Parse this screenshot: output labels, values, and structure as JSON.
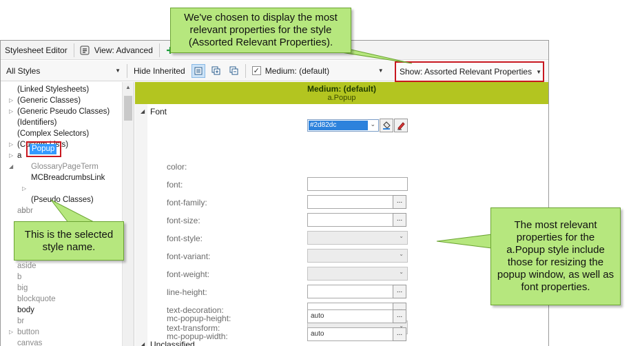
{
  "toolbar1": {
    "title": "Stylesheet Editor",
    "view_label": "View: Advanced"
  },
  "toolbar2": {
    "styles_select": "All Styles",
    "hide_inherited": "Hide Inherited",
    "medium_select": "Medium: (default)",
    "show_select": "Show: Assorted Relevant Properties"
  },
  "tree": {
    "items": [
      "(Linked Stylesheets)",
      "(Generic Classes)",
      "(Generic Pseudo Classes)",
      "(Identifiers)",
      "(Complex Selectors)",
      "(Custom Lists)",
      "a",
      "GlossaryPageTerm",
      "MCBreadcrumbsLink",
      "Popup",
      "(Pseudo Classes)",
      "abbr",
      "aside",
      "b",
      "big",
      "blockquote",
      "body",
      "br",
      "button",
      "canvas"
    ]
  },
  "props": {
    "header_title": "Medium: (default)",
    "header_subtitle": "a.Popup",
    "group_font": "Font",
    "group_unclassified": "Unclassified",
    "rows": [
      {
        "label": "color:",
        "value": "#2d82dc"
      },
      {
        "label": "font:",
        "value": ""
      },
      {
        "label": "font-family:",
        "value": ""
      },
      {
        "label": "font-size:",
        "value": ""
      },
      {
        "label": "font-style:",
        "value": ""
      },
      {
        "label": "font-variant:",
        "value": ""
      },
      {
        "label": "font-weight:",
        "value": ""
      },
      {
        "label": "line-height:",
        "value": ""
      },
      {
        "label": "text-decoration:",
        "value": ""
      },
      {
        "label": "text-transform:",
        "value": ""
      },
      {
        "label": "mc-popup-height:",
        "value": "auto"
      },
      {
        "label": "mc-popup-width:",
        "value": "auto"
      }
    ],
    "ellipsis": "..."
  },
  "callouts": {
    "top": "We've chosen to display the most relevant properties for the style (Assorted Relevant Properties).",
    "left": "This is the selected style name.",
    "right": "The most relevant properties for the a.Popup style include those for resizing the popup window, as well as font properties."
  },
  "colors": {
    "header": "#b3c520",
    "callout": "#b6e77e",
    "highlight_border": "#c8171f",
    "selection": "#3399ff",
    "color_value": "#2d82dc"
  }
}
